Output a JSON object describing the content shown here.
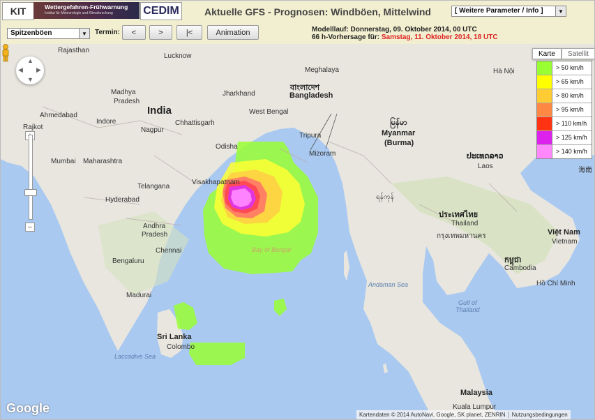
{
  "header": {
    "kit_logo": "KIT",
    "banner_title": "Wettergefahren-Frühwarnung",
    "banner_subtitle": "Institut für Meteorologie und Klimaforschung",
    "cedim_logo": "CEDIM",
    "title": "Aktuelle GFS - Prognosen: Windböen, Mittelwind",
    "parameter_select": "[ Weitere Parameter / Info ]"
  },
  "controls": {
    "variable_select": "Spitzenböen",
    "termin_label": "Termin:",
    "prev_button": "<",
    "next_button": ">",
    "first_button": "|<",
    "animation_button": "Animation",
    "model_run": "Modelllauf: Donnerstag, 09. Oktober 2014, 00 UTC",
    "forecast_prefix": "66 h-Vorhersage für:",
    "forecast_time": "Samstag, 11. Oktober 2014, 18 UTC"
  },
  "map": {
    "map_type": [
      "Karte",
      "Satellit"
    ],
    "legend": [
      {
        "label": "> 50 km/h",
        "color": "#99ff33"
      },
      {
        "label": "> 65 km/h",
        "color": "#ffff00"
      },
      {
        "label": "> 80 km/h",
        "color": "#ffcc33"
      },
      {
        "label": "> 95 km/h",
        "color": "#ff8844"
      },
      {
        "label": "> 110 km/h",
        "color": "#ff3311"
      },
      {
        "label": "> 125 km/h",
        "color": "#dd22ee"
      },
      {
        "label": "> 140 km/h",
        "color": "#ff88ff"
      }
    ],
    "labels": {
      "rajasthan": "Rajasthan",
      "lucknow": "Lucknow",
      "nepal_bhutan": "Meghalaya",
      "india": "India",
      "madhya": "Madhya",
      "pradesh": "Pradesh",
      "ahmedabad": "Ahmedabad",
      "indore": "Indore",
      "jharkhand": "Jharkhand",
      "bangladesh": "Bangladesh",
      "bangladesh_native": "বাংলাদেশ",
      "west_bengal": "West Bengal",
      "chhattisgarh": "Chhattisgarh",
      "nagpur": "Nagpur",
      "rajkot": "Rajkot",
      "tripura": "Tripura",
      "mizoram": "Mizoram",
      "myanmar": "Myanmar",
      "burma": "(Burma)",
      "myanmar_native": "မြန်မာ",
      "mumbai": "Mumbai",
      "maharashtra": "Maharashtra",
      "odisha": "Odisha",
      "telangana": "Telangana",
      "visakhapatnam": "Visakhapatnam",
      "hyderabad": "Hyderabad",
      "andhra": "Andhra",
      "pradesh2": "Pradesh",
      "chennai": "Chennai",
      "bengaluru": "Bengaluru",
      "madurai": "Madurai",
      "bay_of_bengal": "Bay of Bengal",
      "andaman_sea": "Andaman Sea",
      "sri_lanka": "Sri Lanka",
      "colombo": "Colombo",
      "laccadive": "Laccadive Sea",
      "laos": "Laos",
      "laos_native": "ປະເທດລາວ",
      "thailand": "Thailand",
      "thailand_native": "ประเทศไทย",
      "bangkok_native": "กรุงเทพมหานคร",
      "cambodia": "Cambodia",
      "cambodia_native": "កម្ពុជា",
      "viet_nam": "Việt Nam",
      "vietnam": "Vietnam",
      "hcmc": "Hồ Chí Minh",
      "gulf_thailand": "Gulf of",
      "gulf_thailand2": "Thailand",
      "malaysia": "Malaysia",
      "kuala_lumpur": "Kuala Lumpur",
      "hanoi": "Hà Nội",
      "yangon": "ရန်ကုန်",
      "hainan": "海南"
    },
    "google_logo": "Google",
    "attribution": "Kartendaten © 2014 AutoNavi, Google, SK planet, ZENRIN",
    "terms": "Nutzungsbedingungen"
  }
}
